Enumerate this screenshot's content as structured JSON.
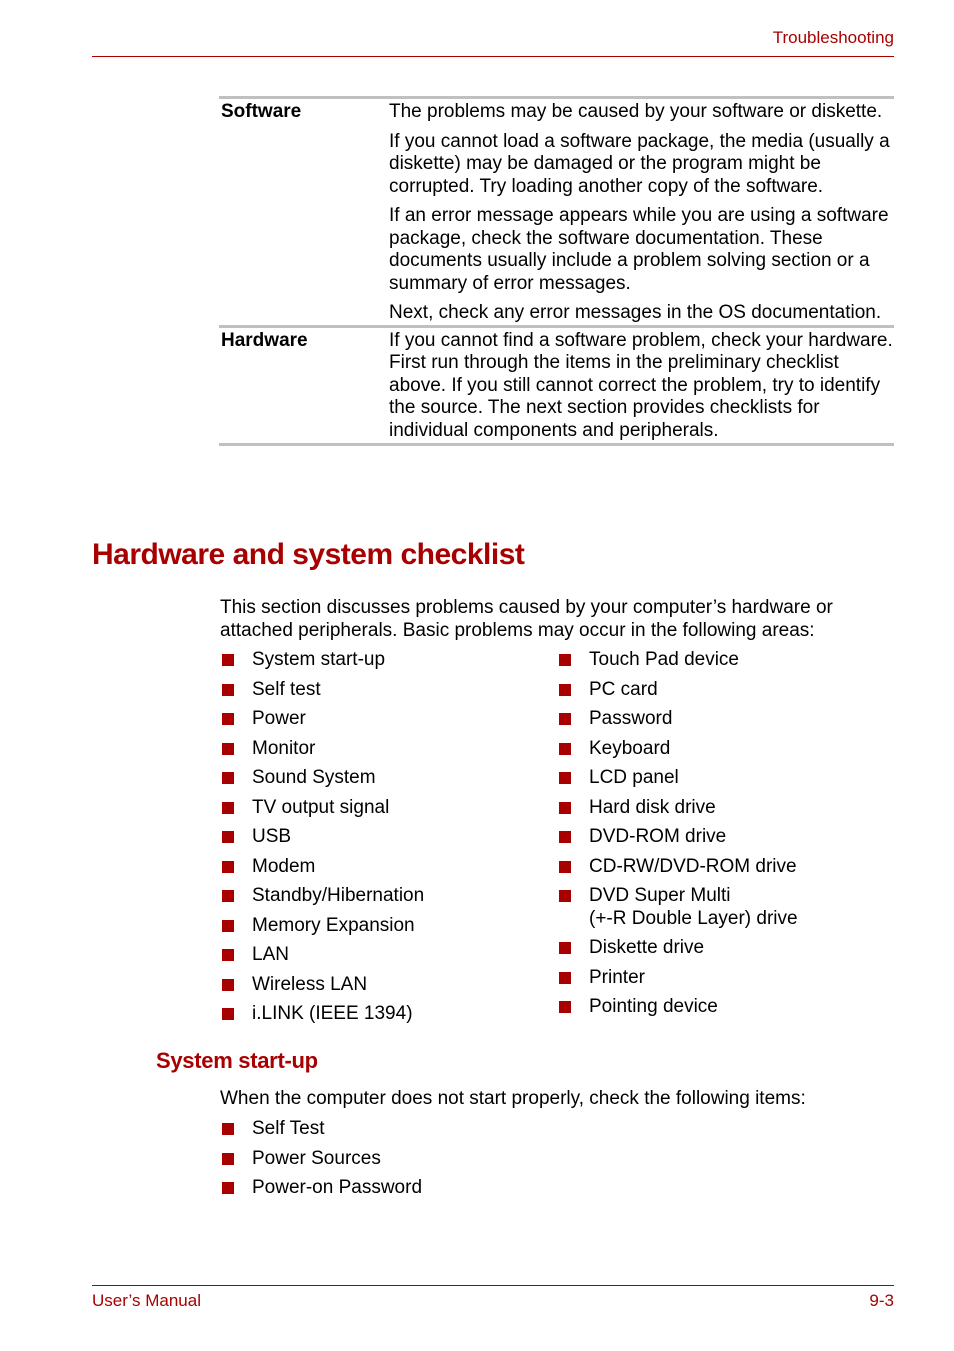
{
  "header": {
    "section": "Troubleshooting"
  },
  "table": {
    "rows": [
      {
        "label": "Software",
        "paragraphs": [
          "The problems may be caused by your software or diskette.",
          "If you cannot load a software package, the media (usually a diskette) may be damaged or the program might be corrupted. Try loading another copy of the software.",
          "If an error message appears while you are using a software package, check the software documentation. These documents usually include a problem solving section or a summary of error messages.",
          "Next, check any error messages in the OS documentation."
        ]
      },
      {
        "label": "Hardware",
        "paragraphs": [
          "If you cannot find a software problem, check your hardware. First run through the items in the preliminary checklist above. If you still cannot correct the problem, try to identify the source. The next section provides checklists for individual components and peripherals."
        ]
      }
    ]
  },
  "checklist": {
    "title": "Hardware and system checklist",
    "intro": "This section discusses problems caused by your computer’s hardware or attached peripherals. Basic problems may occur in the following areas:",
    "left_items": [
      "System start-up",
      "Self test",
      "Power",
      "Monitor",
      "Sound System",
      "TV output signal",
      "USB",
      "Modem",
      "Standby/Hibernation",
      "Memory Expansion",
      "LAN",
      "Wireless LAN",
      "i.LINK (IEEE 1394)"
    ],
    "right_items": [
      "Touch Pad device",
      "PC card",
      "Password",
      "Keyboard",
      "LCD panel",
      "Hard disk drive",
      "DVD-ROM drive",
      "CD-RW/DVD-ROM drive",
      "DVD Super Multi (+-R Double Layer) drive",
      "Diskette drive",
      "Printer",
      "Pointing device"
    ]
  },
  "startup": {
    "title": "System start-up",
    "intro": "When the computer does not start properly, check the following items:",
    "items": [
      "Self Test",
      "Power Sources",
      "Power-on Password"
    ]
  },
  "footer": {
    "left": "User’s Manual",
    "right": "9-3"
  },
  "colors": {
    "accent": "#a80000",
    "table_rule": "#c0c0c0"
  }
}
